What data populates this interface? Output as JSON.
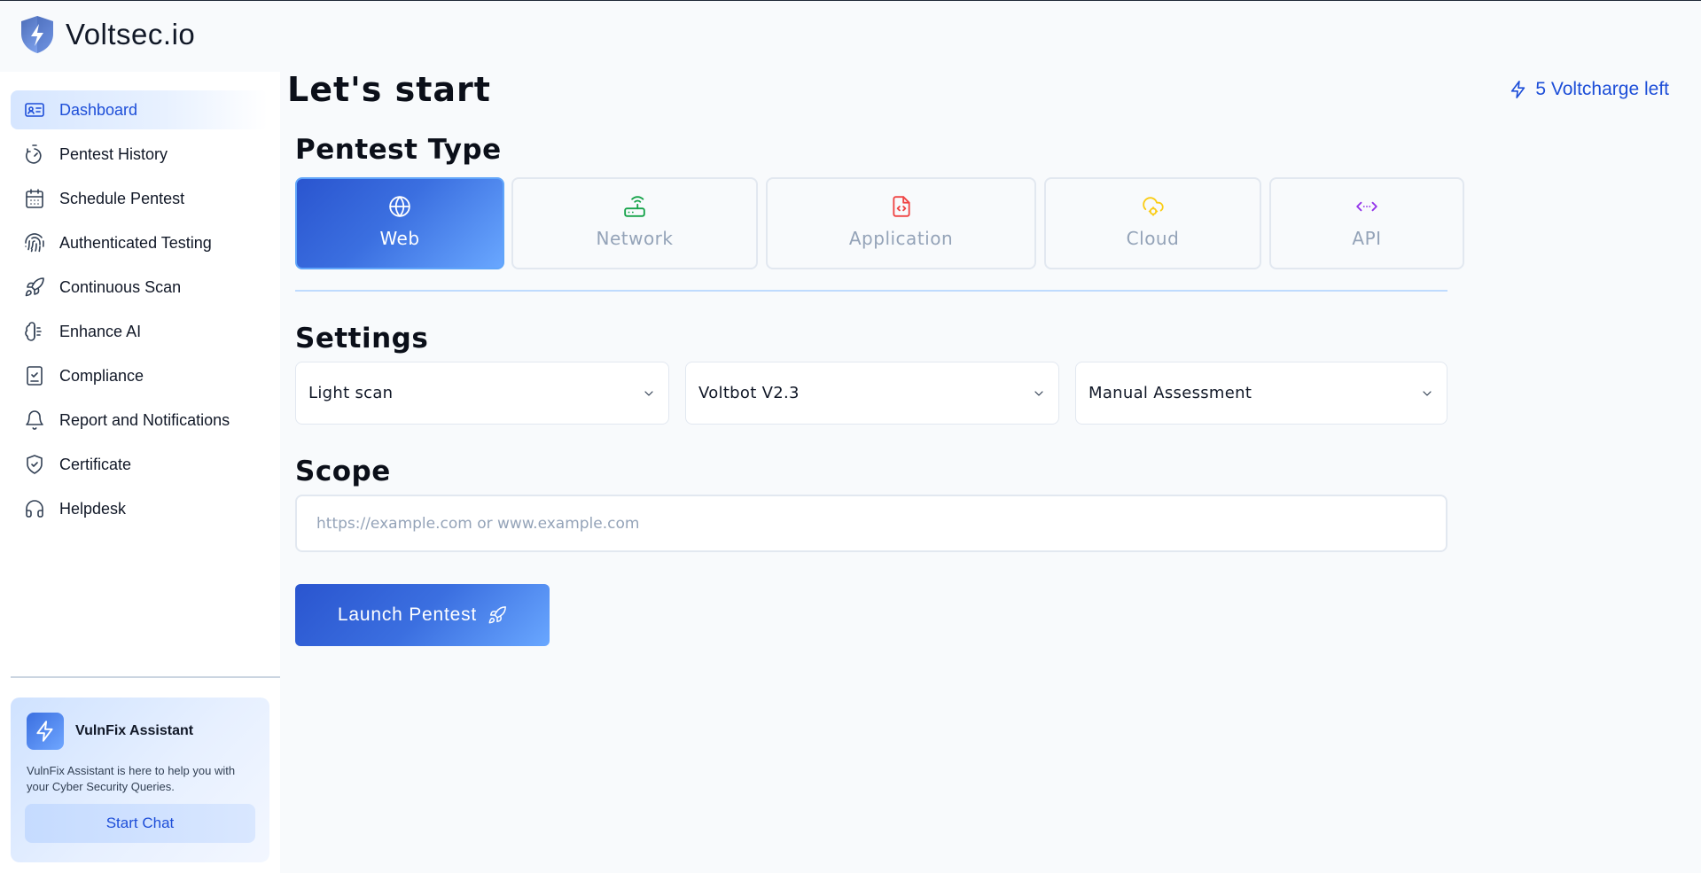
{
  "brand": {
    "name": "Voltsec.io",
    "logo_icon": "shield-bolt-icon"
  },
  "sidebar": {
    "items": [
      {
        "label": "Dashboard",
        "icon": "id-card-icon",
        "active": true
      },
      {
        "label": "Pentest History",
        "icon": "timer-icon"
      },
      {
        "label": "Schedule Pentest",
        "icon": "calendar-icon"
      },
      {
        "label": "Authenticated Testing",
        "icon": "fingerprint-icon"
      },
      {
        "label": "Continuous Scan",
        "icon": "rocket-icon"
      },
      {
        "label": "Enhance AI",
        "icon": "brain-icon"
      },
      {
        "label": "Compliance",
        "icon": "checklist-icon"
      },
      {
        "label": "Report and Notifications",
        "icon": "bell-icon"
      },
      {
        "label": "Certificate",
        "icon": "shield-check-icon"
      },
      {
        "label": "Helpdesk",
        "icon": "headset-icon"
      }
    ],
    "assistant": {
      "title": "VulnFix Assistant",
      "description": "VulnFix Assistant is here to help you with your Cyber Security Queries.",
      "button_label": "Start Chat"
    }
  },
  "main": {
    "title": "Let's start",
    "voltcharge": "5 Voltcharge left",
    "pentest_type": {
      "heading": "Pentest Type",
      "options": [
        {
          "label": "Web",
          "icon": "globe-icon",
          "active": true,
          "color": "#ffffff"
        },
        {
          "label": "Network",
          "icon": "router-icon",
          "color": "#16a34a"
        },
        {
          "label": "Application",
          "icon": "file-code-icon",
          "color": "#ef4444"
        },
        {
          "label": "Cloud",
          "icon": "cloud-cog-icon",
          "color": "#facc15"
        },
        {
          "label": "API",
          "icon": "code-arrows-icon",
          "color": "#9333ea"
        }
      ]
    },
    "settings": {
      "heading": "Settings",
      "scan_type": "Light scan",
      "bot_version": "Voltbot V2.3",
      "assessment": "Manual Assessment"
    },
    "scope": {
      "heading": "Scope",
      "placeholder": "https://example.com or www.example.com",
      "value": ""
    },
    "launch_label": "Launch Pentest"
  },
  "colors": {
    "accent": "#1d4ed8",
    "primary_gradient_start": "#2a55cf",
    "primary_gradient_end": "#69a7ff"
  }
}
